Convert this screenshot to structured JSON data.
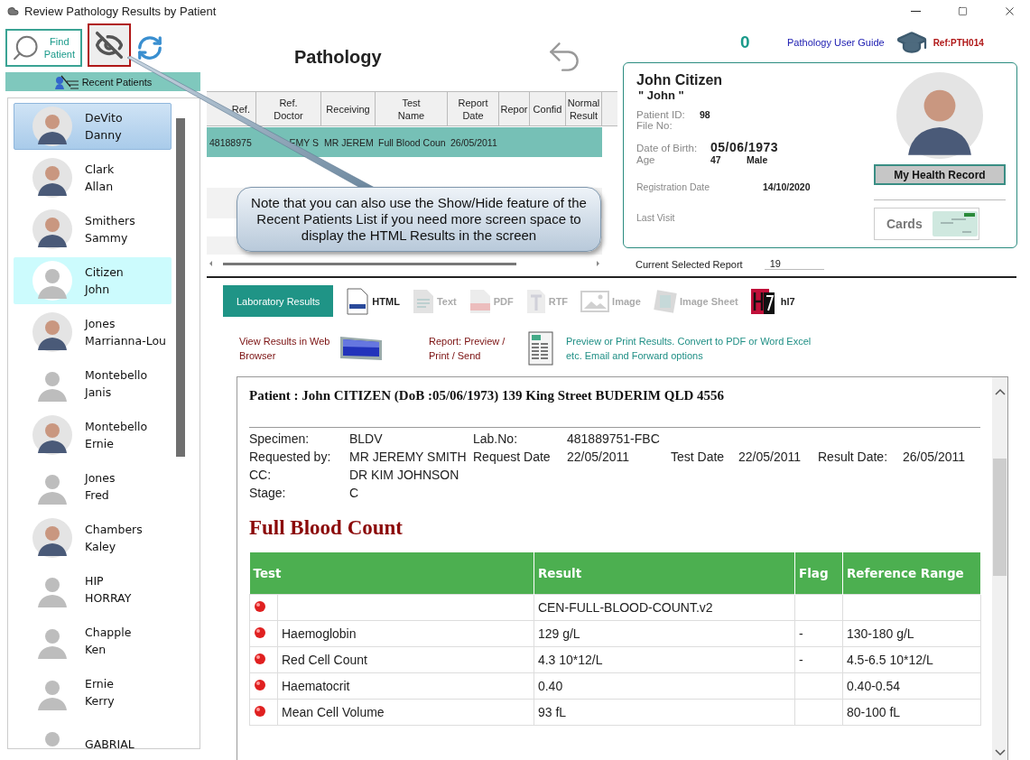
{
  "window": {
    "title": "Review Pathology Results by Patient"
  },
  "toolbar": {
    "find_patient": "Find Patient",
    "show_hide_outlined": true
  },
  "recent_patients": {
    "title": "Recent Patients",
    "items": [
      {
        "last_name": "DeVito",
        "first_name": "Danny",
        "kind": "photo",
        "selected": true,
        "current": false
      },
      {
        "last_name": "Clark",
        "first_name": "Allan",
        "kind": "photo",
        "selected": false,
        "current": false
      },
      {
        "last_name": "Smithers",
        "first_name": "Sammy",
        "kind": "photo",
        "selected": false,
        "current": false
      },
      {
        "last_name": "Citizen",
        "first_name": "John",
        "kind": "placeholder",
        "selected": false,
        "current": true
      },
      {
        "last_name": "Jones",
        "first_name": "Marrianna-Lou",
        "kind": "photo",
        "selected": false,
        "current": false
      },
      {
        "last_name": "Montebello",
        "first_name": "Janis",
        "kind": "placeholder",
        "selected": false,
        "current": false
      },
      {
        "last_name": "Montebello",
        "first_name": "Ernie",
        "kind": "photo",
        "selected": false,
        "current": false
      },
      {
        "last_name": "Jones",
        "first_name": "Fred",
        "kind": "placeholder",
        "selected": false,
        "current": false
      },
      {
        "last_name": "Chambers",
        "first_name": "Kaley",
        "kind": "photo",
        "selected": false,
        "current": false
      },
      {
        "last_name": "HIP",
        "first_name": "HORRAY",
        "kind": "placeholder",
        "selected": false,
        "current": false
      },
      {
        "last_name": "Chapple",
        "first_name": "Ken",
        "kind": "placeholder",
        "selected": false,
        "current": false
      },
      {
        "last_name": "Ernie",
        "first_name": "Kerry",
        "kind": "placeholder",
        "selected": false,
        "current": false
      },
      {
        "last_name": "GABRIAL",
        "kind": "placeholder",
        "selected": false,
        "current": false
      }
    ]
  },
  "header": {
    "title": "Pathology",
    "count": "0",
    "guide_link": "Pathology User Guide",
    "ref": "Ref:PTH014"
  },
  "results_grid": {
    "columns": [
      "Ref.",
      "Ref. Doctor",
      "Receiving",
      "Test Name",
      "Report Date",
      "Repor",
      "Confid",
      "Normal Result"
    ],
    "rows": [
      {
        "cells": [
          "48188975",
          "EMY S",
          "MR JEREM",
          "Full Blood Coun",
          "26/05/2011"
        ],
        "selected": true
      }
    ]
  },
  "callout": "Note that you can also use the Show/Hide feature of the Recent Patients List if you need more screen space to display the HTML Results in the screen",
  "patient_card": {
    "name": "John Citizen",
    "nickname": "\" John \"",
    "patient_id_label": "Patient ID:",
    "patient_id": "98",
    "file_no_label": "File No:",
    "dob_label": "Date of Birth:",
    "dob": "05/06/1973",
    "age_label": "Age",
    "age": "47",
    "sex": "Male",
    "registration_label": "Registration Date",
    "registration": "14/10/2020",
    "last_visit_label": "Last Visit",
    "health_record_button": "My Health Record",
    "cards_button": "Cards"
  },
  "current_report": {
    "label": "Current Selected Report",
    "value": "19"
  },
  "lab_results_button": "Laboratory Results",
  "format_tabs": [
    {
      "label": "HTML",
      "kind": "html",
      "disabled": false
    },
    {
      "label": "Text",
      "kind": "text",
      "disabled": true
    },
    {
      "label": "PDF",
      "kind": "pdf",
      "disabled": true
    },
    {
      "label": "RTF",
      "kind": "rtf",
      "disabled": true
    },
    {
      "label": "Image",
      "kind": "image",
      "disabled": true
    },
    {
      "label": "Image Sheet",
      "kind": "sheet",
      "disabled": true
    },
    {
      "label": "hl7",
      "kind": "hl7",
      "disabled": false
    }
  ],
  "actions": [
    {
      "label": "View Results in Web Browser",
      "kind": "browser"
    },
    {
      "label": "Report:  Preview / Print / Send",
      "kind": "document"
    }
  ],
  "action_note": "Preview or Print Results. Convert to PDF or Word Excel etc. Email and Forward options",
  "report": {
    "patient_line": "Patient : John CITIZEN (DoB :05/06/1973) 139 King Street BUDERIM QLD 4556",
    "details": [
      [
        {
          "label": "Specimen:",
          "value": "BLDV"
        },
        {
          "label": "Lab.No:",
          "value": "481889751-FBC"
        }
      ],
      [
        {
          "label": "Requested by:",
          "value": "MR JEREMY SMITH"
        },
        {
          "label": "Request Date",
          "value": "22/05/2011"
        },
        {
          "label": "Test Date",
          "value": "22/05/2011"
        },
        {
          "label": "Result Date:",
          "value": "26/05/2011"
        }
      ],
      [
        {
          "label": "CC:",
          "value": "DR KIM JOHNSON"
        }
      ],
      [
        {
          "label": "Stage:",
          "value": "C"
        }
      ]
    ],
    "heading": "Full Blood Count",
    "table": {
      "columns": [
        "Test",
        "Result",
        "Flag",
        "Reference Range"
      ],
      "rows": [
        {
          "result": "CEN-FULL-BLOOD-COUNT.v2"
        },
        {
          "test": "Haemoglobin",
          "result": "129 g/L",
          "flag": "-",
          "range": "130-180 g/L"
        },
        {
          "test": "Red Cell Count",
          "result": "4.3 10*12/L",
          "flag": "-",
          "range": "4.5-6.5 10*12/L"
        },
        {
          "test": "Haematocrit",
          "result": "0.40",
          "range": "0.40-0.54"
        },
        {
          "test": "Mean Cell Volume",
          "result": "93 fL",
          "range": "80-100 fL"
        }
      ]
    }
  }
}
